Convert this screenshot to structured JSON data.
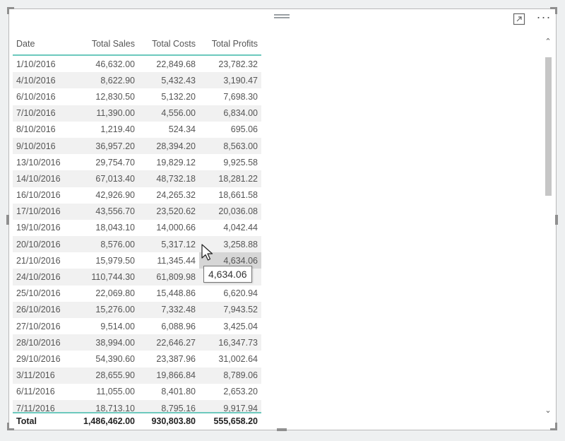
{
  "table": {
    "columns": [
      "Date",
      "Total Sales",
      "Total Costs",
      "Total Profits"
    ],
    "rows": [
      [
        "1/10/2016",
        "46,632.00",
        "22,849.68",
        "23,782.32"
      ],
      [
        "4/10/2016",
        "8,622.90",
        "5,432.43",
        "3,190.47"
      ],
      [
        "6/10/2016",
        "12,830.50",
        "5,132.20",
        "7,698.30"
      ],
      [
        "7/10/2016",
        "11,390.00",
        "4,556.00",
        "6,834.00"
      ],
      [
        "8/10/2016",
        "1,219.40",
        "524.34",
        "695.06"
      ],
      [
        "9/10/2016",
        "36,957.20",
        "28,394.20",
        "8,563.00"
      ],
      [
        "13/10/2016",
        "29,754.70",
        "19,829.12",
        "9,925.58"
      ],
      [
        "14/10/2016",
        "67,013.40",
        "48,732.18",
        "18,281.22"
      ],
      [
        "16/10/2016",
        "42,926.90",
        "24,265.32",
        "18,661.58"
      ],
      [
        "17/10/2016",
        "43,556.70",
        "23,520.62",
        "20,036.08"
      ],
      [
        "19/10/2016",
        "18,043.10",
        "14,000.66",
        "4,042.44"
      ],
      [
        "20/10/2016",
        "8,576.00",
        "5,317.12",
        "3,258.88"
      ],
      [
        "21/10/2016",
        "15,979.50",
        "11,345.44",
        "4,634.06"
      ],
      [
        "24/10/2016",
        "110,744.30",
        "61,809.98",
        ""
      ],
      [
        "25/10/2016",
        "22,069.80",
        "15,448.86",
        "6,620.94"
      ],
      [
        "26/10/2016",
        "15,276.00",
        "7,332.48",
        "7,943.52"
      ],
      [
        "27/10/2016",
        "9,514.00",
        "6,088.96",
        "3,425.04"
      ],
      [
        "28/10/2016",
        "38,994.00",
        "22,646.27",
        "16,347.73"
      ],
      [
        "29/10/2016",
        "54,390.60",
        "23,387.96",
        "31,002.64"
      ],
      [
        "3/11/2016",
        "28,655.90",
        "19,866.84",
        "8,789.06"
      ],
      [
        "6/11/2016",
        "11,055.00",
        "8,401.80",
        "2,653.20"
      ],
      [
        "7/11/2016",
        "18,713.10",
        "8,795.16",
        "9,917.94"
      ]
    ],
    "total": [
      "Total",
      "1,486,462.00",
      "930,803.80",
      "555,658.20"
    ]
  },
  "tooltip": {
    "value": "4,634.06"
  },
  "icons": {
    "focus": "focus-mode-icon",
    "more": "more-options-icon",
    "grip": "drag-grip-icon"
  },
  "colors": {
    "accent": "#6cc9bd",
    "highlight": "#d6d6d6",
    "border": "#b9b9b9"
  }
}
